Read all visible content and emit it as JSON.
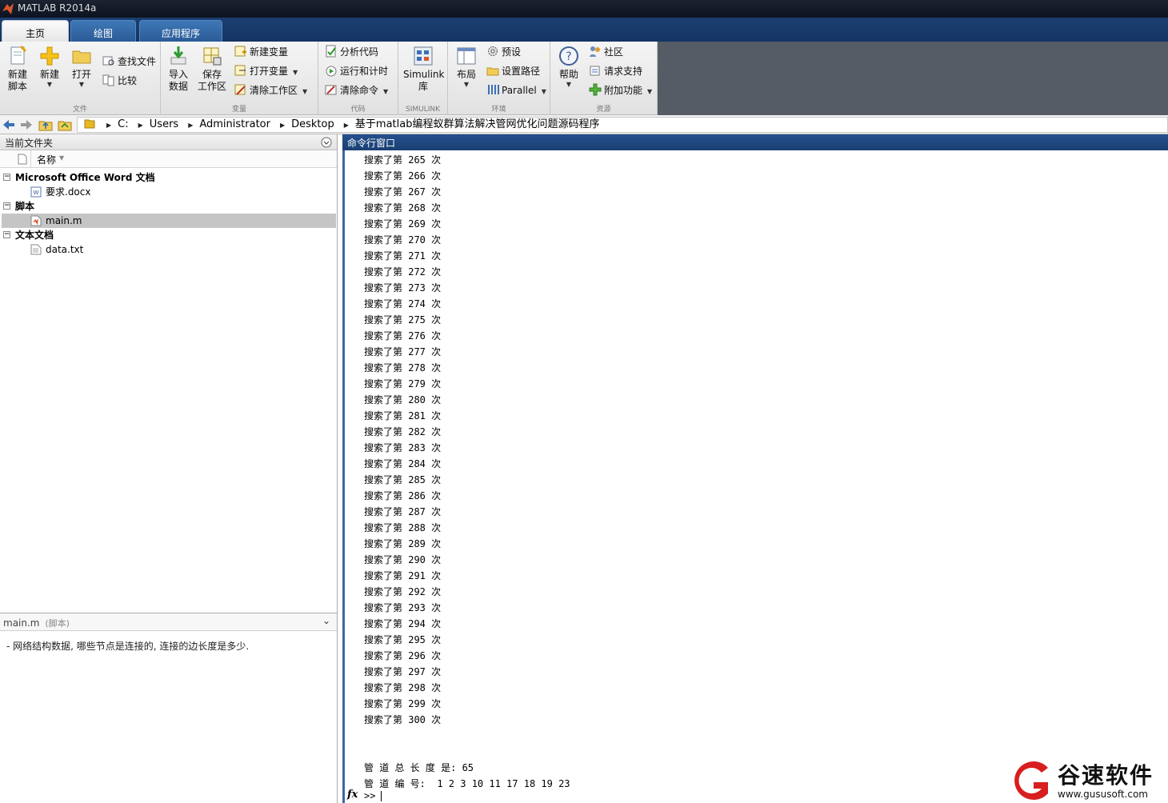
{
  "window": {
    "title": "MATLAB R2014a"
  },
  "tabs": [
    {
      "label": "主页",
      "active": true
    },
    {
      "label": "绘图",
      "active": false
    },
    {
      "label": "应用程序",
      "active": false
    }
  ],
  "ribbon": {
    "file": {
      "group_label": "文件",
      "new_script": "新建\n脚本",
      "new": "新建",
      "open": "打开",
      "find_files": "查找文件",
      "compare": "比较"
    },
    "variable": {
      "group_label": "变量",
      "import": "导入\n数据",
      "save_ws": "保存\n工作区",
      "new_var": "新建变量",
      "open_var": "打开变量",
      "clear_ws": "清除工作区"
    },
    "code": {
      "group_label": "代码",
      "analyze": "分析代码",
      "run_time": "运行和计时",
      "clear_cmd": "清除命令"
    },
    "simulink": {
      "group_label": "SIMULINK",
      "library": "Simulink\n库"
    },
    "env": {
      "group_label": "环境",
      "layout": "布局",
      "prefs": "预设",
      "set_path": "设置路径",
      "parallel": "Parallel"
    },
    "resources": {
      "group_label": "资源",
      "help": "帮助",
      "community": "社区",
      "support": "请求支持",
      "addons": "附加功能"
    }
  },
  "address": {
    "path": [
      "C:",
      "Users",
      "Administrator",
      "Desktop",
      "基于matlab编程蚁群算法解决管网优化问题源码程序"
    ]
  },
  "current_folder": {
    "title": "当前文件夹",
    "col_name": "名称",
    "groups": [
      {
        "label": "Microsoft Office Word 文档",
        "files": [
          "要求.docx"
        ]
      },
      {
        "label": "脚本",
        "files": [
          "main.m"
        ]
      },
      {
        "label": "文本文档",
        "files": [
          "data.txt"
        ]
      }
    ],
    "selected": "main.m",
    "detail_title": "main.m",
    "detail_type": "(脚本)",
    "detail_desc": "-  网络结构数据, 哪些节点是连接的, 连接的边长度是多少."
  },
  "command_window": {
    "title": "命令行窗口",
    "search_prefix": "搜索了第",
    "search_suffix": "次",
    "iterations": [
      265,
      266,
      267,
      268,
      269,
      270,
      271,
      272,
      273,
      274,
      275,
      276,
      277,
      278,
      279,
      280,
      281,
      282,
      283,
      284,
      285,
      286,
      287,
      288,
      289,
      290,
      291,
      292,
      293,
      294,
      295,
      296,
      297,
      298,
      299,
      300
    ],
    "total_length_line": "管 道 总 长 度 是: 65",
    "pipe_ids_line": "管 道 编 号:  1 2 3 10 11 17 18 19 23",
    "fx": "fx",
    "prompt": ">>"
  },
  "watermark": {
    "name": "谷速软件",
    "url": "www.gususoft.com"
  }
}
